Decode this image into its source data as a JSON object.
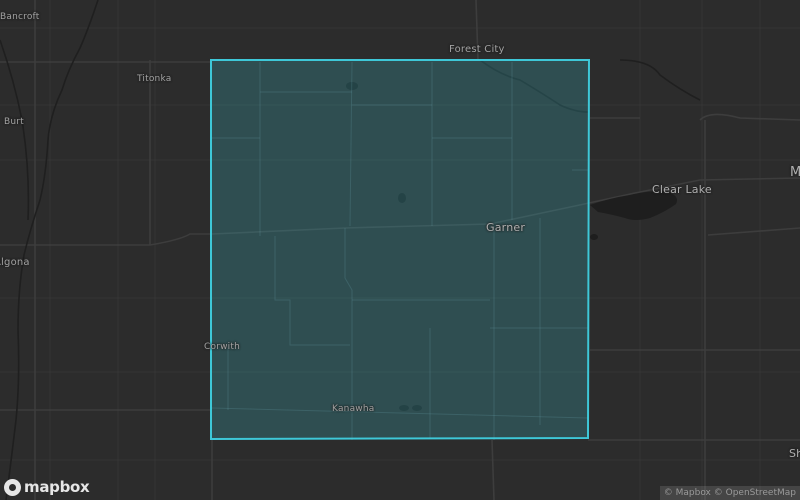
{
  "map": {
    "style": "dark",
    "selection_color": "#3ec8d8",
    "labels": {
      "bancroft": "Bancroft",
      "forest_city": "Forest City",
      "titonka": "Titonka",
      "burt": "Burt",
      "clear_lake": "Clear Lake",
      "garner": "Garner",
      "algona": "Algona",
      "corwith": "Corwith",
      "kanawha": "Kanawha",
      "mason_city": "M",
      "sheffield": "Sh"
    }
  },
  "branding": {
    "logo_text": "mapbox"
  },
  "attribution": {
    "copyright_mapbox": "© Mapbox",
    "copyright_osm": "© OpenStreetMap"
  }
}
